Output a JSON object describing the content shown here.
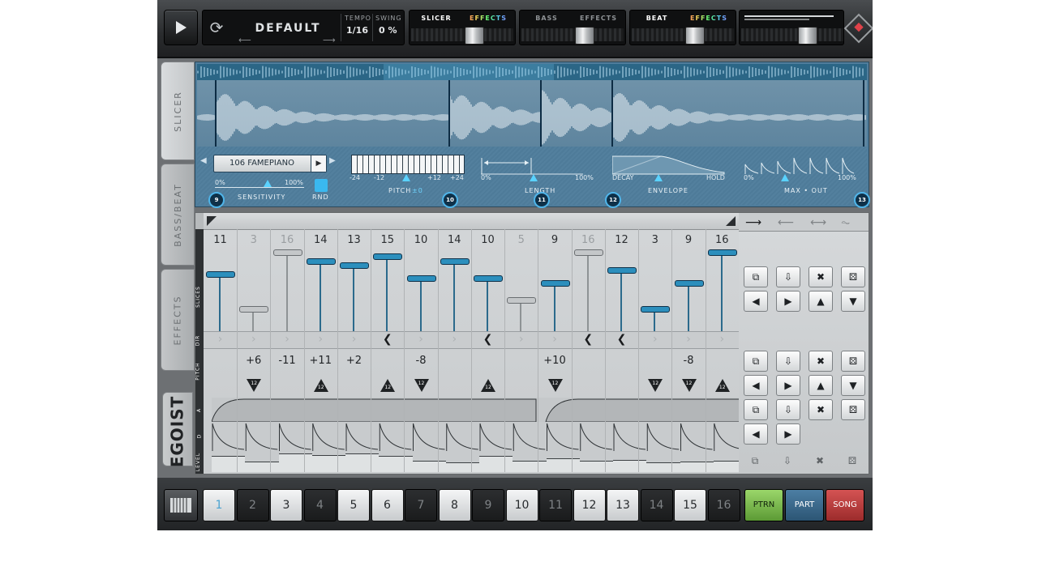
{
  "topbar": {
    "preset": "DEFAULT",
    "tempo_label": "TEMPO",
    "tempo_value": "1/16",
    "swing_label": "SWING",
    "swing_value": "0 %",
    "groups": [
      {
        "tab1": "SLICER",
        "tab2": "EFFECTS",
        "active": "SLICER"
      },
      {
        "tab1": "BASS",
        "tab2": "EFFECTS",
        "active": "none"
      },
      {
        "tab1": "BEAT",
        "tab2": "EFFECTS",
        "active": "BEAT"
      }
    ]
  },
  "sidetabs": [
    "SLICER",
    "BASS/BEAT",
    "EFFECTS"
  ],
  "brand": "EGOIST",
  "slicer": {
    "markers": [
      "9",
      "10",
      "11",
      "12",
      "13"
    ],
    "sample": "106 FAMEPIANO",
    "sensitivity": {
      "label": "SENSITIVITY",
      "min": "0%",
      "max": "100%",
      "rnd": "RND"
    },
    "pitch": {
      "label": "PITCH",
      "value": "±0",
      "ticks": [
        "-24",
        "-12",
        "+12",
        "+24"
      ]
    },
    "length": {
      "label": "LENGTH",
      "min": "0%",
      "max": "100%"
    },
    "envelope": {
      "label": "ENVELOPE",
      "min": "DECAY",
      "max": "HOLD"
    },
    "maxout": {
      "label": "MAX • OUT",
      "min": "0%",
      "max": "100%"
    }
  },
  "rows": {
    "slices": "SLICES",
    "dir": "DIR",
    "pitch": "PITCH",
    "a": "A",
    "d": "D",
    "level": "LEVEL"
  },
  "steps": {
    "slices": [
      "11",
      "3",
      "16",
      "14",
      "13",
      "15",
      "10",
      "14",
      "10",
      "5",
      "9",
      "16",
      "12",
      "3",
      "9",
      "16"
    ],
    "dim": [
      false,
      true,
      true,
      false,
      false,
      false,
      false,
      false,
      false,
      true,
      false,
      true,
      false,
      false,
      false,
      false
    ],
    "pitch": [
      "",
      "+6",
      "-11",
      "+11",
      "+2",
      "",
      "-8",
      "",
      "",
      "",
      "+10",
      "",
      "",
      "",
      "-8",
      ""
    ],
    "twelve": "12"
  },
  "patterns": [
    "1",
    "2",
    "3",
    "4",
    "5",
    "6",
    "7",
    "8",
    "9",
    "10",
    "11",
    "12",
    "13",
    "14",
    "15",
    "16"
  ],
  "modes": [
    "PTRN",
    "PART",
    "SONG"
  ]
}
